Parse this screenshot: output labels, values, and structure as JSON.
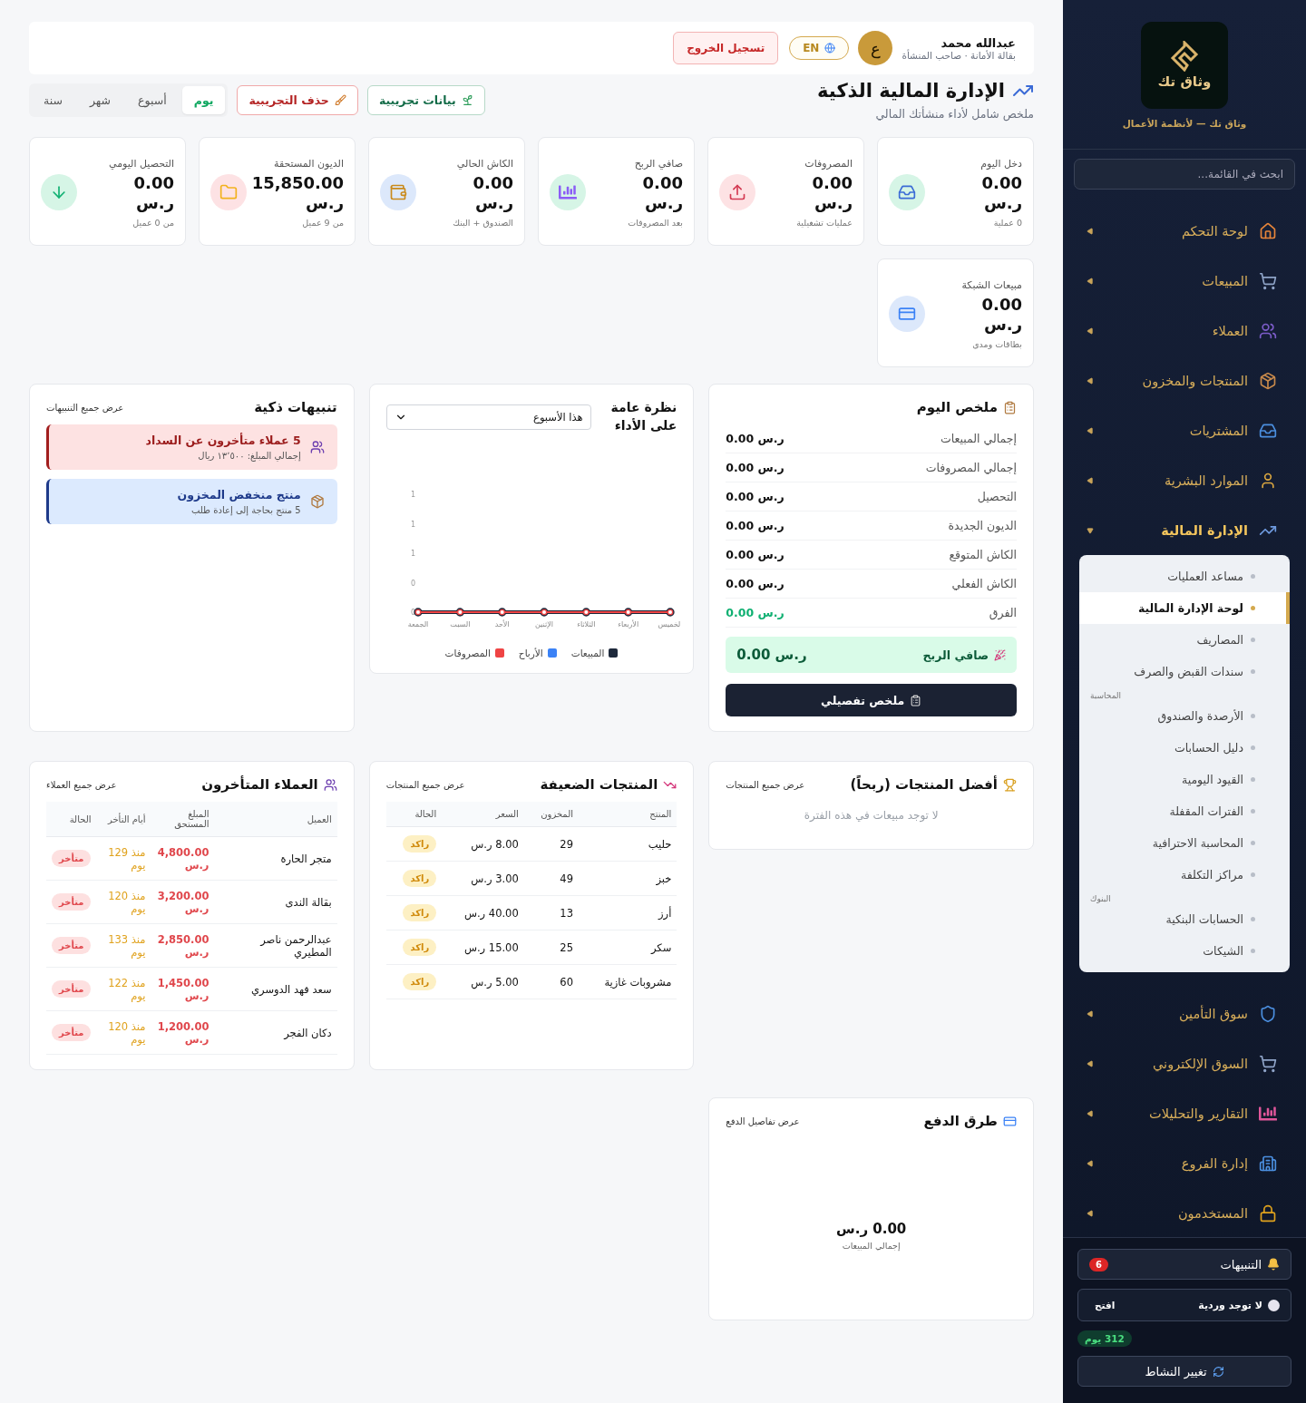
{
  "header": {
    "language": "EN",
    "avatar": "ع",
    "user_name": "عبدالله محمد",
    "user_role": "بقالة الأمانة · صاحب المنشأة",
    "logout": "تسجيل الخروج"
  },
  "page": {
    "title": "الإدارة المالية الذكية",
    "subtitle": "ملخص شامل لأداء منشأتك المالي"
  },
  "actions": [
    {
      "kind": "seed",
      "label": "بيانات تجريبية"
    },
    {
      "kind": "clear",
      "label": "حذف التجريبية"
    }
  ],
  "periods": [
    {
      "label": "يوم",
      "selected": true
    },
    {
      "label": "أسبوع",
      "selected": false
    },
    {
      "label": "شهر",
      "selected": false
    },
    {
      "label": "سنة",
      "selected": false
    }
  ],
  "stats": [
    {
      "kind": "income",
      "label": "دخل اليوم",
      "value": "0.00 ر.س",
      "note": "0 عملية"
    },
    {
      "kind": "expense",
      "label": "المصروفات",
      "value": "0.00 ر.س",
      "note": "عمليات تشغيلية"
    },
    {
      "kind": "profit",
      "label": "صافي الربح",
      "value": "0.00 ر.س",
      "note": "بعد المصروفات"
    },
    {
      "kind": "cash",
      "label": "الكاش الحالي",
      "value": "0.00 ر.س",
      "note": "الصندوق + البنك"
    },
    {
      "kind": "debt",
      "label": "الديون المستحقة",
      "value": "15,850.00 ر.س",
      "note": "من 9 عميل"
    },
    {
      "kind": "collection",
      "label": "التحصيل اليومي",
      "value": "0.00 ر.س",
      "note": "من 0 عميل"
    },
    {
      "kind": "card",
      "label": "مبيعات الشبكة",
      "value": "0.00 ر.س",
      "note": "بطاقات ومدى"
    }
  ],
  "daily_summary": {
    "title": "ملخص اليوم",
    "rows": [
      {
        "label": "إجمالي المبيعات",
        "value": "0.00 ر.س",
        "positive": false
      },
      {
        "label": "إجمالي المصروفات",
        "value": "0.00 ر.س",
        "positive": false
      },
      {
        "label": "التحصيل",
        "value": "0.00 ر.س",
        "positive": false
      },
      {
        "label": "الديون الجديدة",
        "value": "0.00 ر.س",
        "positive": false
      },
      {
        "label": "الكاش المتوقع",
        "value": "0.00 ر.س",
        "positive": false
      },
      {
        "label": "الكاش الفعلي",
        "value": "0.00 ر.س",
        "positive": false
      },
      {
        "label": "الفرق",
        "value": "0.00 ر.س",
        "positive": true
      }
    ],
    "profit": {
      "label": "صافي الربح",
      "value": "0.00 ر.س"
    },
    "button": "ملخص تفصيلي"
  },
  "performance": {
    "title": "نظرة عامة على الأداء",
    "period": "هذا الأسبوع",
    "chart_data": {
      "type": "line",
      "categories": [
        "الجمعة",
        "السبت",
        "الأحد",
        "الإثنين",
        "الثلاثاء",
        "الأربعاء",
        "الخميس"
      ],
      "series": [
        {
          "name": "المبيعات",
          "color": "#1e293b",
          "marker": "circle",
          "values": [
            0,
            0,
            0,
            0,
            0,
            0,
            0
          ]
        },
        {
          "name": "الأرباح",
          "color": "#3b82f6",
          "values": [
            null,
            null,
            null,
            null,
            null,
            null,
            null
          ]
        },
        {
          "name": "المصروفات",
          "color": "#ef4444",
          "marker": "circle",
          "values": [
            0,
            0,
            0,
            0,
            0,
            0,
            0
          ]
        }
      ],
      "ylim": [
        0,
        1
      ],
      "yticks": [
        {
          "value": 0,
          "label": "0"
        },
        {
          "value": 0.25,
          "label": "0"
        },
        {
          "value": 0.5,
          "label": "1"
        },
        {
          "value": 0.75,
          "label": "1"
        },
        {
          "value": 1,
          "label": "1"
        }
      ]
    }
  },
  "alerts": {
    "title": "تنبيهات ذكية",
    "link": "عرض جميع التنبيهات",
    "items": [
      {
        "kind": "danger",
        "title": "5 عملاء متأخرون عن السداد",
        "text": "إجمالي المبلغ: ١٣٬٥٠٠ ريال"
      },
      {
        "kind": "info",
        "title": "منتج منخفض المخزون",
        "text": "5 منتج بحاجة إلى إعادة طلب"
      }
    ]
  },
  "top_products": {
    "title": "أفضل المنتجات (ربحاً)",
    "link": "عرض جميع المنتجات",
    "empty": "لا توجد مبيعات في هذه الفترة"
  },
  "weak_products": {
    "title": "المنتجات الضعيفة",
    "link": "عرض جميع المنتجات",
    "columns": [
      "المنتج",
      "المخزون",
      "السعر",
      "الحالة"
    ],
    "rows": [
      {
        "product": "حليب",
        "stock": "29",
        "price": "8.00 ر.س",
        "status": "راكد"
      },
      {
        "product": "خبز",
        "stock": "49",
        "price": "3.00 ر.س",
        "status": "راكد"
      },
      {
        "product": "أرز",
        "stock": "13",
        "price": "40.00 ر.س",
        "status": "راكد"
      },
      {
        "product": "سكر",
        "stock": "25",
        "price": "15.00 ر.س",
        "status": "راكد"
      },
      {
        "product": "مشروبات غازية",
        "stock": "60",
        "price": "5.00 ر.س",
        "status": "راكد"
      }
    ]
  },
  "late_customers": {
    "title": "العملاء المتأخرون",
    "link": "عرض جميع العملاء",
    "columns": [
      "العميل",
      "المبلغ المستحق",
      "أيام التأخر",
      "الحالة"
    ],
    "rows": [
      {
        "customer": "متجر الحارة",
        "amount": "4,800.00 ر.س",
        "days": "منذ 129 يوم",
        "status": "متأخر"
      },
      {
        "customer": "بقالة الندى",
        "amount": "3,200.00 ر.س",
        "days": "منذ 120 يوم",
        "status": "متأخر"
      },
      {
        "customer": "عبدالرحمن ناصر المطيري",
        "amount": "2,850.00 ر.س",
        "days": "منذ 133 يوم",
        "status": "متأخر"
      },
      {
        "customer": "سعد فهد الدوسري",
        "amount": "1,450.00 ر.س",
        "days": "منذ 122 يوم",
        "status": "متأخر"
      },
      {
        "customer": "دكان الفجر",
        "amount": "1,200.00 ر.س",
        "days": "منذ 120 يوم",
        "status": "متأخر"
      }
    ]
  },
  "payment_methods": {
    "title": "طرق الدفع",
    "link": "عرض تفاصيل الدفع",
    "value": "0.00 ر.س",
    "label": "إجمالي المبيعات"
  },
  "sidebar": {
    "logo_text": "وثاق تك",
    "tagline": "وثاق تك — لأنظمة الأعمال",
    "search_placeholder": "ابحث في القائمة...",
    "nav": [
      {
        "label": "لوحة التحكم",
        "expanded": false
      },
      {
        "label": "المبيعات",
        "expanded": false
      },
      {
        "label": "العملاء",
        "expanded": false
      },
      {
        "label": "المنتجات والمخزون",
        "expanded": false
      },
      {
        "label": "المشتريات",
        "expanded": false
      },
      {
        "label": "الموارد البشرية",
        "expanded": false
      },
      {
        "label": "الإدارة المالية",
        "expanded": true,
        "submenu": [
          {
            "items": [
              {
                "label": "مساعد العمليات",
                "selected": false
              },
              {
                "label": "لوحة الإدارة المالية",
                "selected": true
              },
              {
                "label": "المصاريف",
                "selected": false
              },
              {
                "label": "سندات القبض والصرف",
                "selected": false
              }
            ]
          },
          {
            "section": "المحاسبة",
            "items": [
              {
                "label": "الأرصدة والصندوق",
                "selected": false
              },
              {
                "label": "دليل الحسابات",
                "selected": false
              },
              {
                "label": "القيود اليومية",
                "selected": false
              },
              {
                "label": "الفترات المقفلة",
                "selected": false
              },
              {
                "label": "المحاسبة الاحترافية",
                "selected": false
              },
              {
                "label": "مراكز التكلفة",
                "selected": false
              }
            ]
          },
          {
            "section": "البنوك",
            "items": [
              {
                "label": "الحسابات البنكية",
                "selected": false
              },
              {
                "label": "الشيكات",
                "selected": false
              }
            ]
          }
        ]
      },
      {
        "label": "سوق التأمين",
        "expanded": false
      },
      {
        "label": "السوق الإلكتروني",
        "expanded": false
      },
      {
        "label": "التقارير والتحليلات",
        "expanded": false
      },
      {
        "label": "إدارة الفروع",
        "expanded": false
      },
      {
        "label": "المستخدمون",
        "expanded": false
      }
    ],
    "notifications": {
      "label": "التنبيهات",
      "count": "6"
    },
    "shift": {
      "label": "لا توجد وردية",
      "action": "افتح"
    },
    "days_badge": "312 يوم",
    "switch_button": "تغيير النشاط"
  }
}
